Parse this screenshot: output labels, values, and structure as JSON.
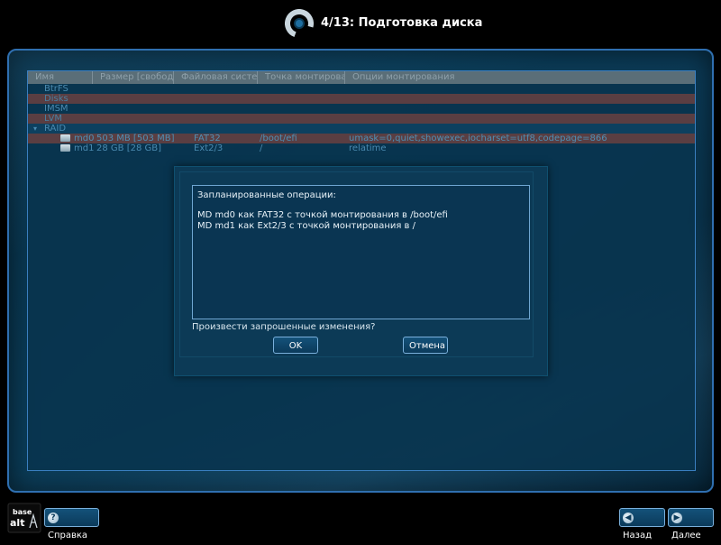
{
  "header": {
    "title": "4/13: Подготовка диска"
  },
  "table": {
    "columns": [
      "Имя",
      "Размер [свободно]",
      "Файловая система",
      "Точка монтирования",
      "Опции монтирования"
    ],
    "groups": [
      {
        "name": "BtrFS"
      },
      {
        "name": "Disks"
      },
      {
        "name": "IMSM"
      },
      {
        "name": "LVM"
      },
      {
        "name": "RAID",
        "expander": "▾"
      }
    ],
    "rows": [
      {
        "name": "md0",
        "size": "503 MB [503 MB]",
        "fs": "FAT32",
        "mount": "/boot/efi",
        "options": "umask=0,quiet,showexec,iocharset=utf8,codepage=866"
      },
      {
        "name": "md1",
        "size": "28 GB [28 GB]",
        "fs": "Ext2/3",
        "mount": "/",
        "options": "relatime"
      }
    ]
  },
  "dialog": {
    "heading": "Запланированные операции:",
    "operations": [
      "MD md0 как FAT32 с точкой монтирования в /boot/efi",
      "MD md1 как Ext2/3 с точкой монтирования в /"
    ],
    "question": "Произвести запрошенные изменения?",
    "ok_label": "OK",
    "cancel_label": "Отмена"
  },
  "footer": {
    "logo_text_top": "base",
    "logo_text_bottom": "alt",
    "help_label": "Справка",
    "back_label": "Назад",
    "next_label": "Далее"
  },
  "icons": {
    "help": "question-icon",
    "back": "arrow-left-icon",
    "next": "arrow-right-icon",
    "drive": "drive-icon",
    "logo": "installer-ring-icon"
  },
  "colors": {
    "frame_border": "#2f6fb0",
    "panel_bg": "#0a3c58",
    "button_border": "#7ab0dc",
    "selected_row": "#5a3e42"
  }
}
